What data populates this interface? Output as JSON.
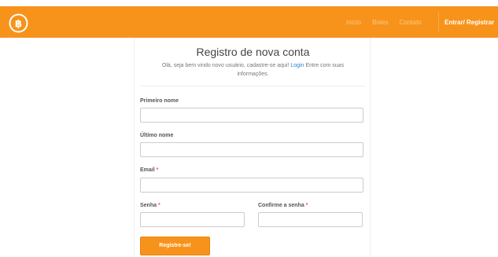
{
  "nav": {
    "links": [
      "Início",
      "Botes",
      "Contato"
    ],
    "cta": "Entrar/ Registrar",
    "logo_icon": "bitcoin-logo-icon",
    "color": "#f7931a"
  },
  "form": {
    "title": "Registro de nova conta",
    "intro_before": "Olá, seja bem vindo novo usuário, cadastre-se aqui! ",
    "intro_link": "Login",
    "intro_after": " Entre com suas informações.",
    "first_name_label": "Primeiro nome",
    "first_name_value": "",
    "last_name_label": "Último nome",
    "last_name_value": "",
    "email_label": "Email",
    "email_value": "",
    "password_label": "Senha",
    "password_value": "",
    "confirm_label": "Confirme a senha",
    "confirm_value": "",
    "required_mark": "*",
    "submit_label": "Registre-se!"
  }
}
